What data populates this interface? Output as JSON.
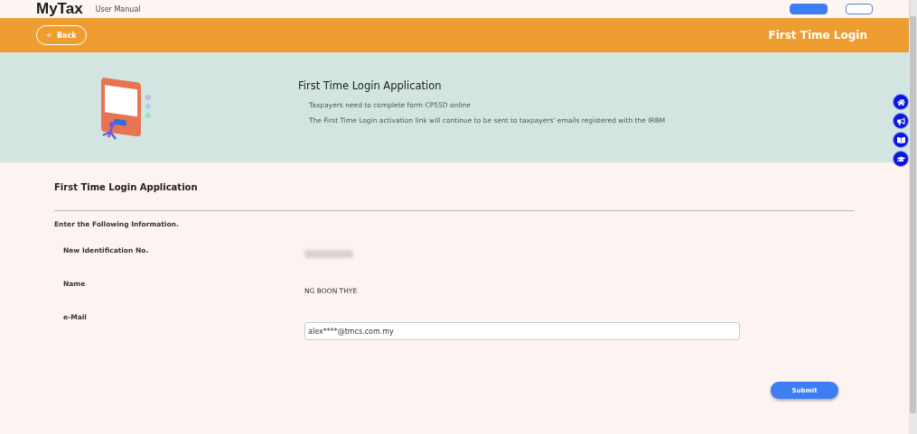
{
  "header": {
    "logo": "MyTax",
    "subtitle": "User Manual"
  },
  "title_bar": {
    "back": "Back",
    "title": "First Time Login"
  },
  "banner": {
    "heading": "First Time Login Application",
    "lines": [
      "Taxpayers need to complete form CP55D online",
      "The First Time Login activation link will continue to be sent to taxpayers' emails registered with the IRBM"
    ]
  },
  "side_buttons": [
    {
      "kind": "home"
    },
    {
      "kind": "announce"
    },
    {
      "kind": "book"
    },
    {
      "kind": "graduation"
    }
  ],
  "form": {
    "title": "First Time Login Application",
    "instruction": "Enter the Following Information.",
    "fields": [
      {
        "label": "New Identification No.",
        "kind": "hidden"
      },
      {
        "label": "Name",
        "kind": "text",
        "value": "NG BOON THYE"
      },
      {
        "label": "e-Mail",
        "kind": "input",
        "value": "alex****@tmcs.com.my"
      }
    ],
    "submit": "Submit"
  }
}
